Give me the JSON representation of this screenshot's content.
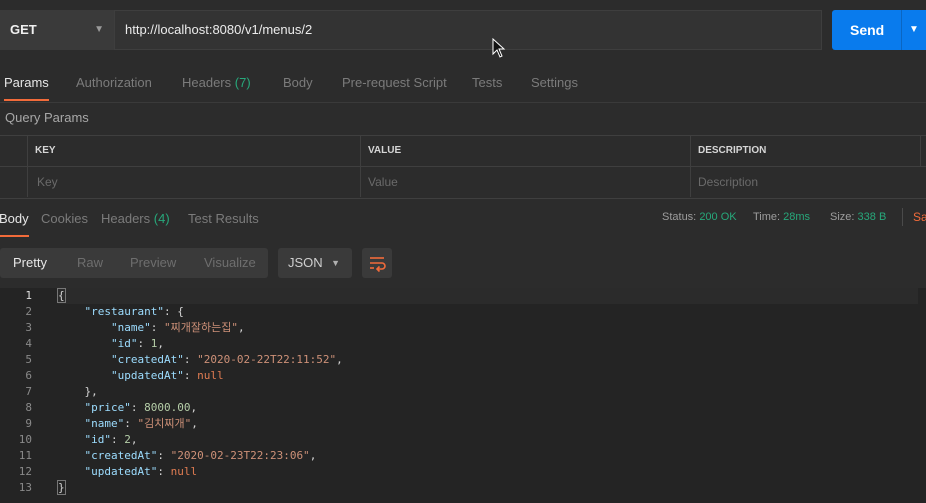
{
  "request": {
    "method": "GET",
    "url": "http://localhost:8080/v1/menus/2",
    "send_label": "Send"
  },
  "request_tabs": [
    {
      "label": "Params",
      "active": true
    },
    {
      "label": "Authorization"
    },
    {
      "label": "Headers",
      "count": "(7)"
    },
    {
      "label": "Body"
    },
    {
      "label": "Pre-request Script"
    },
    {
      "label": "Tests"
    },
    {
      "label": "Settings"
    }
  ],
  "query_params": {
    "title": "Query Params",
    "headers": [
      "KEY",
      "VALUE",
      "DESCRIPTION"
    ],
    "placeholders": [
      "Key",
      "Value",
      "Description"
    ]
  },
  "response_tabs": [
    {
      "label": "Body",
      "active": true
    },
    {
      "label": "Cookies"
    },
    {
      "label": "Headers",
      "count": "(4)"
    },
    {
      "label": "Test Results"
    }
  ],
  "response_status": {
    "status_label": "Status:",
    "status_value": "200 OK",
    "time_label": "Time:",
    "time_value": "28ms",
    "size_label": "Size:",
    "size_value": "338 B",
    "save_label": "Sa"
  },
  "viewer": {
    "modes": [
      "Pretty",
      "Raw",
      "Preview",
      "Visualize"
    ],
    "active_mode": "Pretty",
    "format": "JSON"
  },
  "response_body": {
    "line_numbers": [
      "1",
      "2",
      "3",
      "4",
      "5",
      "6",
      "7",
      "8",
      "9",
      "10",
      "11",
      "12",
      "13"
    ],
    "restaurant_key": "\"restaurant\"",
    "r_name_key": "\"name\"",
    "r_name_val": "\"찌개잘하는집\"",
    "r_id_key": "\"id\"",
    "r_id_val": "1",
    "r_created_key": "\"createdAt\"",
    "r_created_val": "\"2020-02-22T22:11:52\"",
    "r_updated_key": "\"updatedAt\"",
    "r_updated_val": "null",
    "price_key": "\"price\"",
    "price_val": "8000.00",
    "name_key": "\"name\"",
    "name_val": "\"김치찌개\"",
    "id_key": "\"id\"",
    "id_val": "2",
    "created_key": "\"createdAt\"",
    "created_val": "\"2020-02-23T22:23:06\"",
    "updated_key": "\"updatedAt\"",
    "updated_val": "null"
  },
  "colors": {
    "accent": "#f26b3a",
    "send": "#097bed",
    "count_green": "#27a87b",
    "background": "#2c2c2c",
    "code_background": "#242424"
  }
}
